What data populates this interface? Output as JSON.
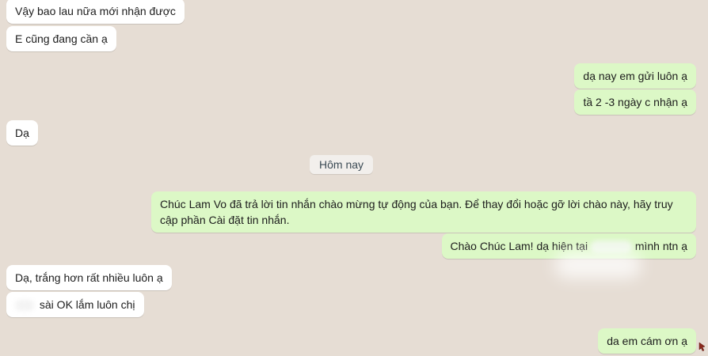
{
  "messages": [
    {
      "dir": "in",
      "text": "Vậy bao lau nữa mới nhận được"
    },
    {
      "dir": "in",
      "text": "E cũng đang cần ạ"
    },
    {
      "dir": "out",
      "text": "dạ nay em gửi luôn ạ"
    },
    {
      "dir": "out",
      "text": "tầ 2 -3 ngày c nhận ạ"
    },
    {
      "dir": "in",
      "text": "Dạ"
    },
    {
      "dir": "out",
      "text": "Chúc Lam Vo đã trả lời tin nhắn chào mừng tự động của bạn. Để thay đổi hoặc gỡ lời chào này, hãy truy cập phần Cài đặt tin nhắn."
    },
    {
      "dir": "out",
      "text_before": "Chào Chúc Lam! dạ hiện tại",
      "text_after": "mình ntn ạ"
    },
    {
      "dir": "in",
      "text": "Dạ, trắng hơn rất nhiều luôn ạ"
    },
    {
      "dir": "in",
      "text": "sài OK lắm luôn chị"
    },
    {
      "dir": "out",
      "text": "da em cám ơn ạ"
    }
  ],
  "day_separator": "Hôm nay",
  "colors": {
    "background": "#e6ddd4",
    "incoming_bubble": "#ffffff",
    "outgoing_bubble": "#dcf8c6"
  }
}
